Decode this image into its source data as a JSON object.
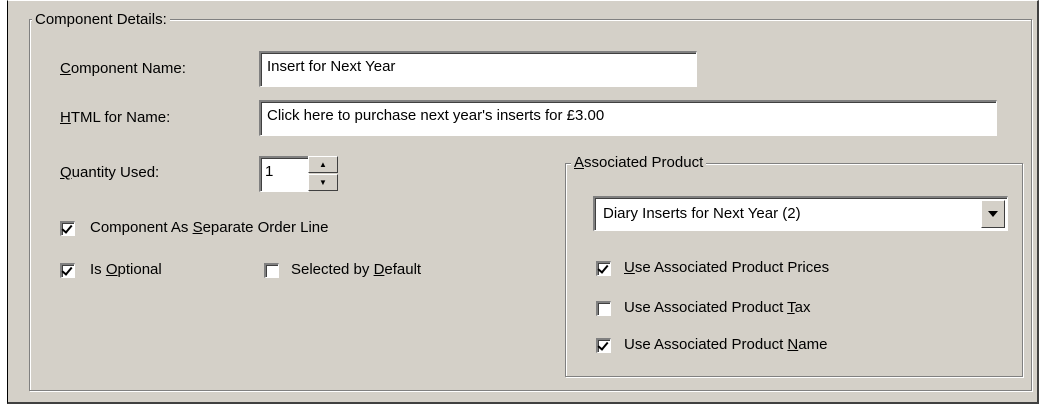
{
  "component_details": {
    "legend": "Component Details:",
    "component_name": {
      "label_ul": "C",
      "label_rest": "omponent Name:",
      "value": "Insert for Next Year"
    },
    "html_for_name": {
      "label_ul": "H",
      "label_rest": "TML for Name:",
      "value": "Click here to purchase next year's inserts for £3.00"
    },
    "quantity_used": {
      "label_ul": "Q",
      "label_rest": "uantity Used:",
      "value": "1"
    },
    "separate_order_line": {
      "label_pre": "Component As ",
      "label_ul": "S",
      "label_post": "eparate Order Line",
      "checked": true
    },
    "is_optional": {
      "label_pre": "Is ",
      "label_ul": "O",
      "label_post": "ptional",
      "checked": true
    },
    "selected_by_default": {
      "label_pre": "Selected by ",
      "label_ul": "D",
      "label_post": "efault",
      "checked": false
    }
  },
  "associated_product": {
    "legend_ul": "A",
    "legend_rest": "ssociated Product",
    "selected_product": "Diary Inserts for Next Year (2)",
    "use_prices": {
      "label_ul": "U",
      "label_post": "se Associated Product Prices",
      "checked": true
    },
    "use_tax": {
      "label_pre": "Use Associated Product ",
      "label_ul": "T",
      "label_post": "ax",
      "checked": false
    },
    "use_name": {
      "label_pre": "Use Associated Product ",
      "label_ul": "N",
      "label_post": "ame",
      "checked": true
    }
  }
}
